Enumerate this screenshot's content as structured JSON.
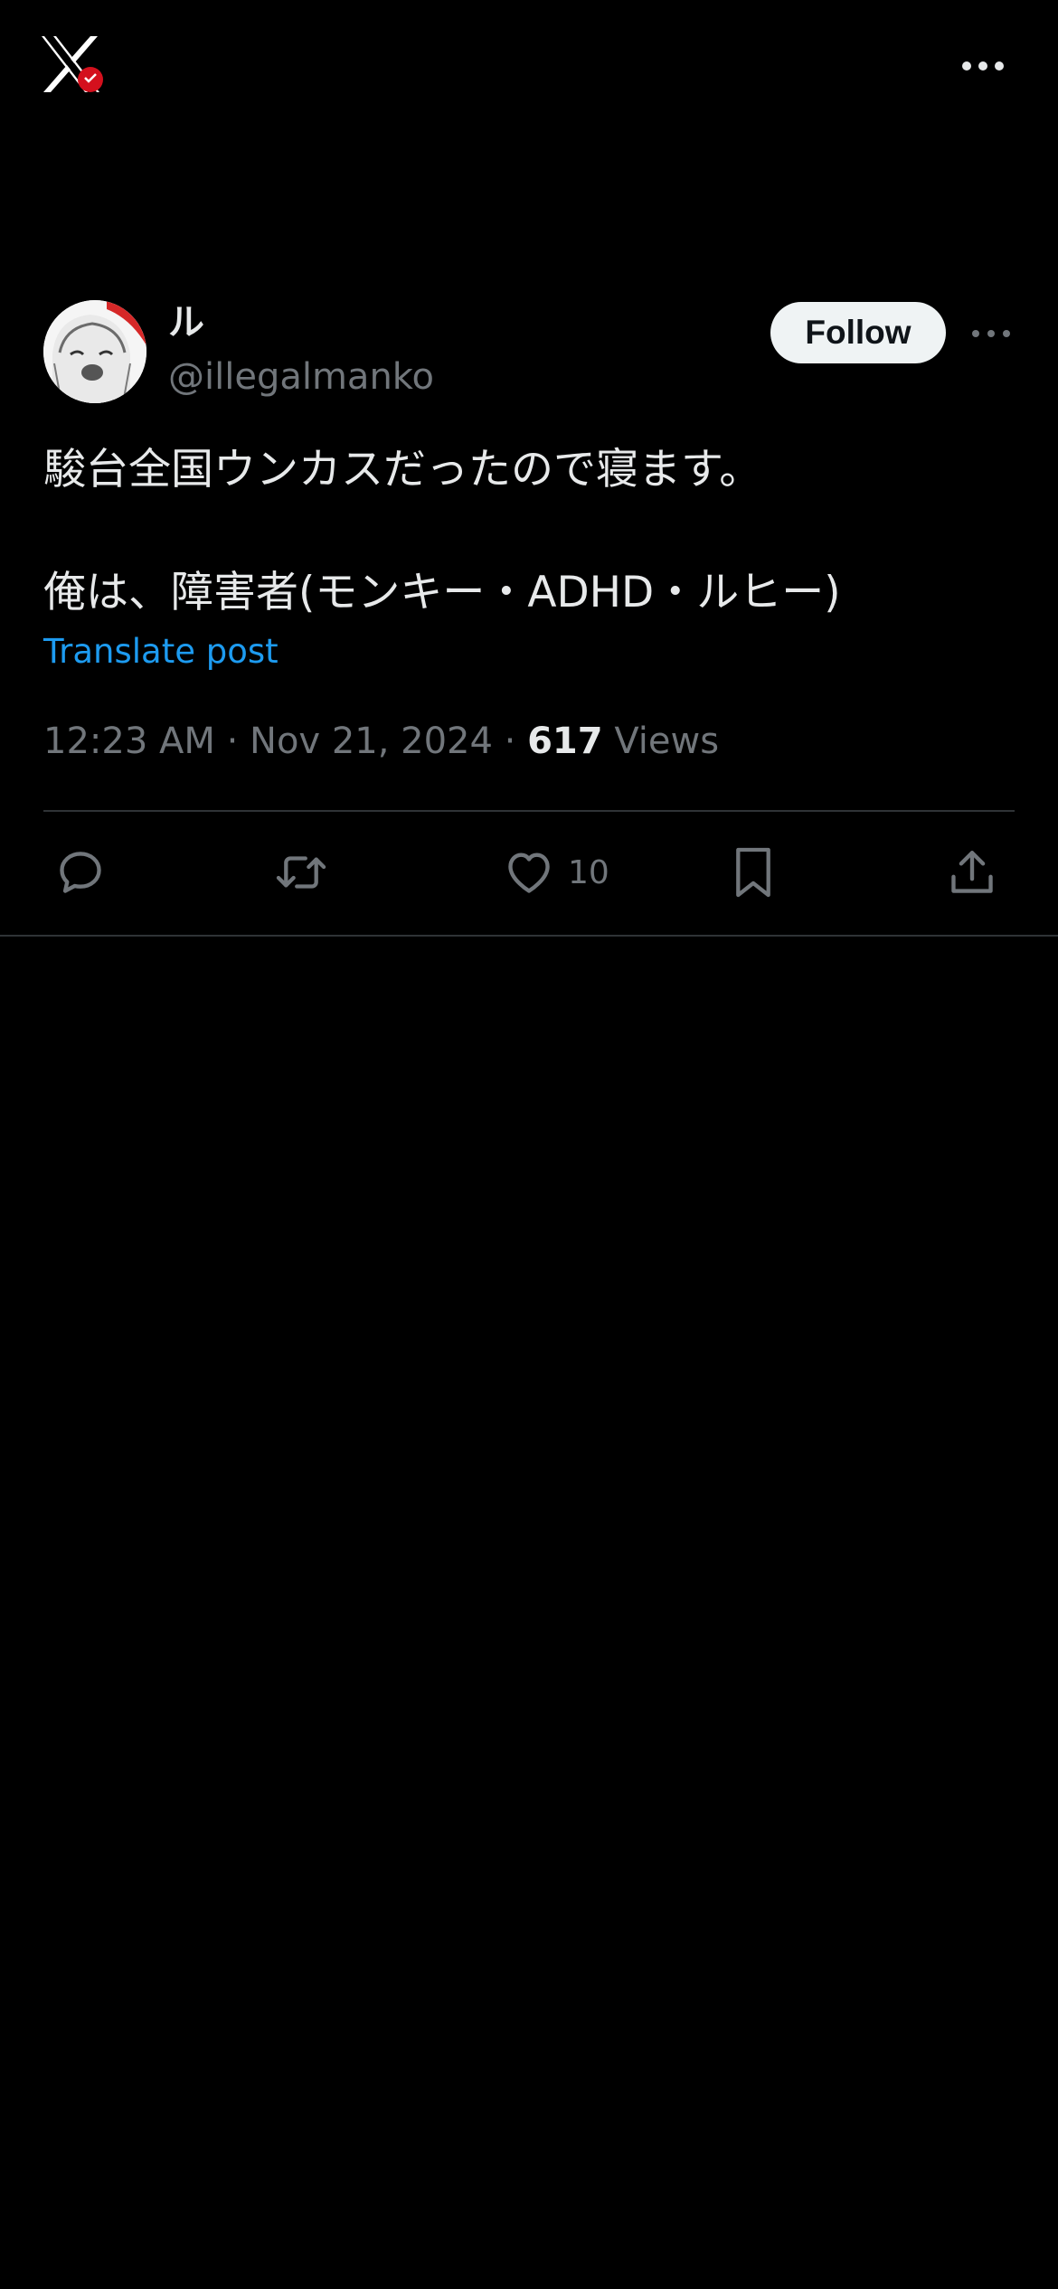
{
  "app": {
    "logo": "x-logo-icon",
    "logo_badge": "red-badge",
    "menu_icon": "more-horizontal-icon"
  },
  "post": {
    "author": {
      "display_name": "ル",
      "handle": "@illegalmanko",
      "avatar": "anime-avatar",
      "follow_label": "Follow",
      "more_icon": "more-horizontal-icon"
    },
    "text_lines": [
      "駿台全国ウンカスだったので寝ます。",
      "",
      "俺は、障害者(モンキー・ADHD・ルヒー)"
    ],
    "translate_label": "Translate post",
    "time": "12:23 AM",
    "separator": "·",
    "date": "Nov 21, 2024",
    "views_count": "617",
    "views_label": "Views"
  },
  "actions": {
    "reply_icon": "reply-icon",
    "repost_icon": "repost-icon",
    "like_icon": "heart-icon",
    "like_count": "10",
    "bookmark_icon": "bookmark-icon",
    "share_icon": "share-icon"
  },
  "colors": {
    "background": "#000000",
    "primary_text": "#e7e9ea",
    "secondary_text": "#71767b",
    "link": "#1d9bf0",
    "divider": "#2f3336",
    "follow_bg": "#eff3f4"
  }
}
